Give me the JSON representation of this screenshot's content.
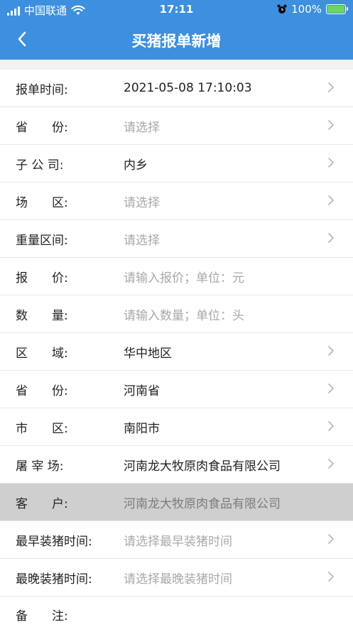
{
  "status_bar": {
    "carrier": "中国联通",
    "time": "17:11",
    "battery": "100%"
  },
  "nav": {
    "title": "买猪报单新增"
  },
  "form": {
    "rows": [
      {
        "label": "报单时间:",
        "value": "2021-05-08 17:10:03",
        "state": "filled",
        "arrow": true
      },
      {
        "label": "省　　份:",
        "value": "请选择",
        "state": "placeholder",
        "arrow": true
      },
      {
        "label": "子 公 司:",
        "value": "内乡",
        "state": "filled",
        "arrow": true
      },
      {
        "label": "场　　区:",
        "value": "请选择",
        "state": "placeholder",
        "arrow": true
      },
      {
        "label": "重量区间:",
        "value": "请选择",
        "state": "placeholder",
        "arrow": true
      },
      {
        "label": "报　　价:",
        "value": "请输入报价；单位：元",
        "state": "placeholder",
        "arrow": false
      },
      {
        "label": "数　　量:",
        "value": "请输入数量；单位：头",
        "state": "placeholder",
        "arrow": false
      },
      {
        "label": "区　　域:",
        "value": "华中地区",
        "state": "filled",
        "arrow": true
      },
      {
        "label": "省　　份:",
        "value": "河南省",
        "state": "filled",
        "arrow": true
      },
      {
        "label": "市　　区:",
        "value": "南阳市",
        "state": "filled",
        "arrow": true
      },
      {
        "label": "屠 宰 场:",
        "value": "河南龙大牧原肉食品有限公司",
        "state": "filled",
        "arrow": true
      },
      {
        "label": "客　　户:",
        "value": "河南龙大牧原肉食品有限公司",
        "state": "disabled",
        "arrow": false
      },
      {
        "label": "最早装猪时间:",
        "value": "请选择最早装猪时间",
        "state": "placeholder",
        "arrow": true
      },
      {
        "label": "最晚装猪时间:",
        "value": "请选择最晚装猪时间",
        "state": "placeholder",
        "arrow": true
      },
      {
        "label": "备　　注:",
        "value": "",
        "state": "placeholder",
        "arrow": false
      }
    ]
  },
  "colors": {
    "header": "#3d8fe0",
    "placeholder": "#a8a8a8",
    "disabled_row": "#cfcfcf"
  }
}
